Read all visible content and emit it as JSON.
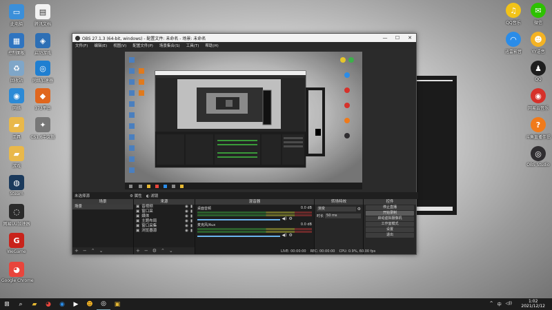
{
  "desktop_left": [
    {
      "label": "此电脑",
      "icon": "computer-icon",
      "color": "#3b8fd9",
      "glyph": "▭"
    },
    {
      "label": "腾讯文档",
      "icon": "document-icon",
      "color": "#f2f2f2",
      "glyph": "▤"
    },
    {
      "label": "控制面板",
      "icon": "control-panel-icon",
      "color": "#2f74c0",
      "glyph": "▦"
    },
    {
      "label": "启动游戏",
      "icon": "game-launcher-icon",
      "color": "#2d6fb5",
      "glyph": "◈"
    },
    {
      "label": "回收站",
      "icon": "recycle-bin-icon",
      "color": "#7fa6c8",
      "glyph": "♻"
    },
    {
      "label": "网络加速器",
      "icon": "network-accelerator-icon",
      "color": "#1f7fd1",
      "glyph": "◎"
    },
    {
      "label": "网络",
      "icon": "network-icon",
      "color": "#2c8ad6",
      "glyph": "◉"
    },
    {
      "label": "173平台",
      "icon": "platform-173-icon",
      "color": "#e0661d",
      "glyph": "◆"
    },
    {
      "label": "工具",
      "icon": "folder-tools-icon",
      "color": "#e9b84a",
      "glyph": "▰"
    },
    {
      "label": "CS1.6中文版",
      "icon": "cs-icon",
      "color": "#777",
      "glyph": "✦"
    },
    {
      "label": "游戏",
      "icon": "folder-games-icon",
      "color": "#e9b84a",
      "glyph": "▰"
    },
    {
      "label": "Steam",
      "icon": "steam-icon",
      "color": "#1b3a5c",
      "glyph": "◍"
    },
    {
      "label": "网易UU加速器",
      "icon": "uu-accelerator-icon",
      "color": "#2b2b2b",
      "glyph": "◌"
    },
    {
      "label": "WeGame",
      "icon": "wegame-icon",
      "color": "#c9231b",
      "glyph": "G"
    },
    {
      "label": "Google Chrome",
      "icon": "chrome-icon",
      "color": "#e8453c",
      "glyph": "◕"
    }
  ],
  "desktop_right": [
    {
      "label": "QQ音乐",
      "icon": "qq-music-icon",
      "color": "#f2c318",
      "glyph": "♫"
    },
    {
      "label": "微信",
      "icon": "wechat-icon",
      "color": "#2dc100",
      "glyph": "✉"
    },
    {
      "label": "迅雷影音",
      "icon": "thunder-player-icon",
      "color": "#2a8ce8",
      "glyph": "◠"
    },
    {
      "label": "YY语音",
      "icon": "yy-icon",
      "color": "#f4b324",
      "glyph": "☻"
    },
    {
      "label": "QQ",
      "icon": "qq-icon",
      "color": "#1e1e1e",
      "glyph": "♟"
    },
    {
      "label": "网易云音乐",
      "icon": "netease-music-icon",
      "color": "#d6312a",
      "glyph": "◉"
    },
    {
      "label": "斗鱼直播伴侣",
      "icon": "douyu-icon",
      "color": "#f07a1a",
      "glyph": "?"
    },
    {
      "label": "OBS Studio",
      "icon": "obs-icon",
      "color": "#302e31",
      "glyph": "◎"
    }
  ],
  "obs": {
    "title": "OBS 27.1.3 (64-bit, windows) - 配置文件: 未命名 - 场景: 未命名",
    "menus": [
      "文件(F)",
      "编辑(E)",
      "视图(V)",
      "配置文件(P)",
      "场景集合(S)",
      "工具(T)",
      "帮助(H)"
    ],
    "scene_label": "未选择源",
    "props_label": "属性",
    "filters_label": "滤镜",
    "docks": {
      "scenes": {
        "title": "场景",
        "items": [
          "场景"
        ]
      },
      "sources": {
        "title": "来源",
        "items": [
          "音视频",
          "窗口采",
          "媒体",
          "主题布局",
          "窗口采集",
          "浏览器源"
        ]
      },
      "mixer": {
        "title": "混音器",
        "tracks": [
          {
            "name": "桌面音频",
            "db": "0.0 dB"
          },
          {
            "name": "麦克风/Aux",
            "db": "0.0 dB"
          }
        ]
      },
      "transitions": {
        "title": "转场特效",
        "type": "渐变",
        "duration_label": "时长",
        "duration_value": "50 ms"
      },
      "controls": {
        "title": "控件",
        "buttons": [
          "停止直播",
          "开始录制",
          "启动虚拟摄像机",
          "工作室模式",
          "设置",
          "退出"
        ]
      }
    },
    "status": {
      "live": "LIVE: 00:00:00",
      "rec": "REC: 00:00:00",
      "cpu": "CPU: 0.9%, 60.00 fps"
    }
  },
  "taskbar": {
    "tray_items": [
      "^",
      "中",
      "◁))"
    ],
    "time": "1:02",
    "date": "2021/12/12"
  }
}
